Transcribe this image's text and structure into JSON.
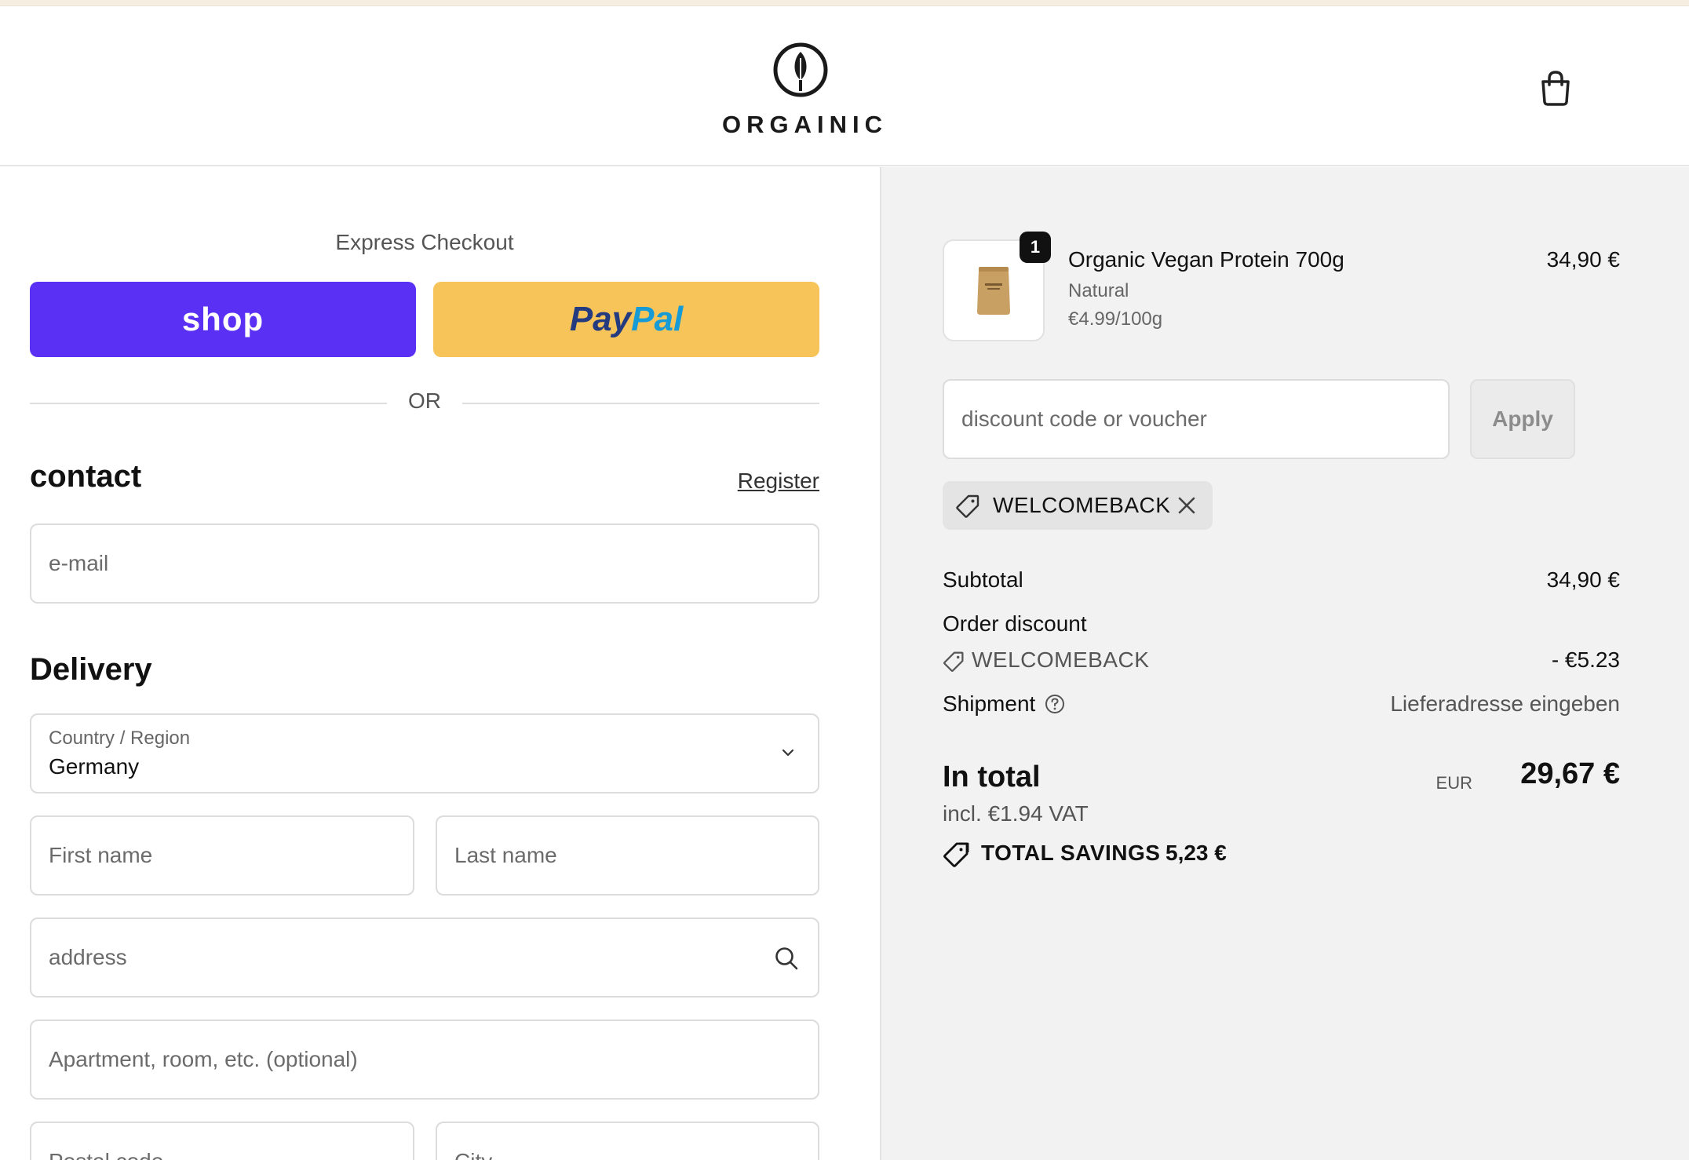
{
  "brand": {
    "name": "ORGAINIC"
  },
  "express": {
    "title": "Express Checkout",
    "shop_label": "shop",
    "paypal_part1": "Pay",
    "paypal_part2": "Pal",
    "or_label": "OR"
  },
  "contact": {
    "heading": "contact",
    "register_link": "Register",
    "email_placeholder": "e-mail"
  },
  "delivery": {
    "heading": "Delivery",
    "country_label": "Country / Region",
    "country_value": "Germany",
    "first_name_placeholder": "First name",
    "last_name_placeholder": "Last name",
    "address_placeholder": "address",
    "apartment_placeholder": "Apartment, room, etc. (optional)",
    "postal_placeholder": "Postal code",
    "city_placeholder": "City"
  },
  "cart": {
    "item": {
      "quantity": "1",
      "name": "Organic Vegan Protein 700g",
      "variant": "Natural",
      "unit_price": "€4.99/100g",
      "price": "34,90 €"
    },
    "discount_placeholder": "discount code or voucher",
    "apply_label": "Apply",
    "applied_code": "WELCOMEBACK"
  },
  "summary": {
    "subtotal_label": "Subtotal",
    "subtotal_value": "34,90 €",
    "order_discount_label": "Order discount",
    "discount_code": "WELCOMEBACK",
    "discount_value": "- €5.23",
    "shipment_label": "Shipment",
    "shipment_value": "Lieferadresse eingeben",
    "total_label": "In total",
    "total_currency": "EUR",
    "total_value": "29,67 €",
    "vat_text": "incl. €1.94 VAT",
    "savings_label": "TOTAL SAVINGS",
    "savings_value": "5,23 €"
  },
  "colors": {
    "shop_pay": "#5a31f4",
    "paypal_yellow": "#f7c45a",
    "paypal_dark_blue": "#253b80",
    "paypal_light_blue": "#179bd7",
    "summary_bg": "#f2f2f2"
  },
  "icons": {
    "logo": "leaf-circle-icon",
    "cart": "shopping-bag-icon",
    "select": "chevron-down-icon",
    "address": "search-icon",
    "code": "tag-icon",
    "remove": "close-icon",
    "help": "question-circle-icon"
  }
}
